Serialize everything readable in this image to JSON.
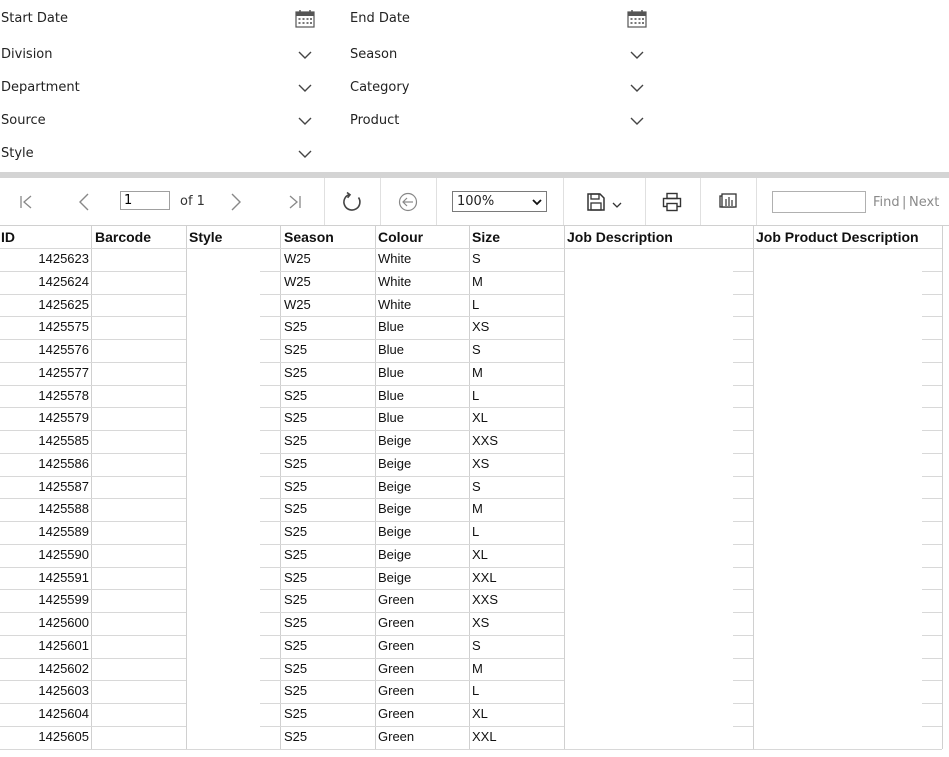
{
  "filters": {
    "start_date": "Start Date",
    "end_date": "End Date",
    "division": "Division",
    "season": "Season",
    "department": "Department",
    "category": "Category",
    "source": "Source",
    "product": "Product",
    "style": "Style"
  },
  "toolbar": {
    "page_value": "1",
    "of_label": "of 1",
    "zoom": "100%",
    "find_label": "Find",
    "separator": "|",
    "next_label": "Next"
  },
  "icons": {
    "first": "first-page-icon",
    "prev": "previous-page-icon",
    "next": "next-page-icon",
    "last": "last-page-icon",
    "refresh": "refresh-icon",
    "back": "back-icon",
    "save": "save-icon",
    "print": "print-icon",
    "layout": "print-layout-icon",
    "calendar": "calendar-icon",
    "dropdown": "chevron-down-icon"
  },
  "table": {
    "headers": [
      "ID",
      "Barcode",
      "Style",
      "Season",
      "Colour",
      "Size",
      "Job Description",
      "Job Product Description"
    ],
    "rows": [
      [
        "1425623",
        "",
        "",
        "W25",
        "White",
        "S",
        "",
        ""
      ],
      [
        "1425624",
        "",
        "",
        "W25",
        "White",
        "M",
        "",
        ""
      ],
      [
        "1425625",
        "",
        "",
        "W25",
        "White",
        "L",
        "",
        ""
      ],
      [
        "1425575",
        "",
        "",
        "S25",
        "Blue",
        "XS",
        "",
        ""
      ],
      [
        "1425576",
        "",
        "",
        "S25",
        "Blue",
        "S",
        "",
        ""
      ],
      [
        "1425577",
        "",
        "",
        "S25",
        "Blue",
        "M",
        "",
        ""
      ],
      [
        "1425578",
        "",
        "",
        "S25",
        "Blue",
        "L",
        "",
        ""
      ],
      [
        "1425579",
        "",
        "",
        "S25",
        "Blue",
        "XL",
        "",
        ""
      ],
      [
        "1425585",
        "",
        "",
        "S25",
        "Beige",
        "XXS",
        "",
        ""
      ],
      [
        "1425586",
        "",
        "",
        "S25",
        "Beige",
        "XS",
        "",
        ""
      ],
      [
        "1425587",
        "",
        "",
        "S25",
        "Beige",
        "S",
        "",
        ""
      ],
      [
        "1425588",
        "",
        "",
        "S25",
        "Beige",
        "M",
        "",
        ""
      ],
      [
        "1425589",
        "",
        "",
        "S25",
        "Beige",
        "L",
        "",
        ""
      ],
      [
        "1425590",
        "",
        "",
        "S25",
        "Beige",
        "XL",
        "",
        ""
      ],
      [
        "1425591",
        "",
        "",
        "S25",
        "Beige",
        "XXL",
        "",
        ""
      ],
      [
        "1425599",
        "",
        "",
        "S25",
        "Green",
        "XXS",
        "",
        ""
      ],
      [
        "1425600",
        "",
        "",
        "S25",
        "Green",
        "XS",
        "",
        ""
      ],
      [
        "1425601",
        "",
        "",
        "S25",
        "Green",
        "S",
        "",
        ""
      ],
      [
        "1425602",
        "",
        "",
        "S25",
        "Green",
        "M",
        "",
        ""
      ],
      [
        "1425603",
        "",
        "",
        "S25",
        "Green",
        "L",
        "",
        ""
      ],
      [
        "1425604",
        "",
        "",
        "S25",
        "Green",
        "XL",
        "",
        ""
      ],
      [
        "1425605",
        "",
        "",
        "S25",
        "Green",
        "XXL",
        "",
        ""
      ]
    ]
  }
}
